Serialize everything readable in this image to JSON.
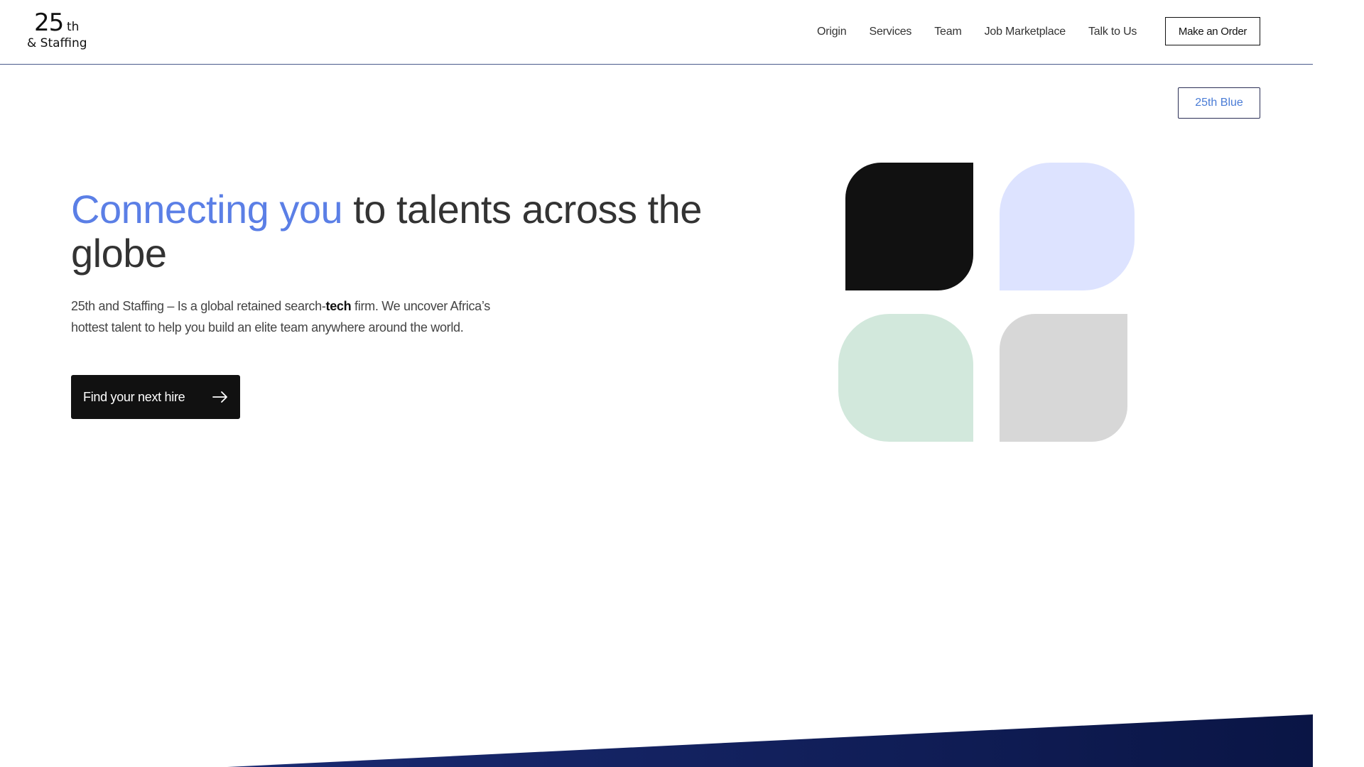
{
  "logo": {
    "number": "25",
    "suffix": "th",
    "tagline": "& Staffing"
  },
  "nav": {
    "items": [
      {
        "label": "Origin"
      },
      {
        "label": "Services"
      },
      {
        "label": "Team"
      },
      {
        "label": "Job Marketplace"
      },
      {
        "label": "Talk to Us"
      }
    ],
    "order_button": "Make an Order"
  },
  "switcher": {
    "label": "25th Blue"
  },
  "hero": {
    "title_accent": "Connecting you",
    "title_rest": " to talents across the globe",
    "desc_before": "25th and Staffing – Is a global retained search-",
    "desc_bold": "tech",
    "desc_after": " firm. We uncover Africa’s hottest talent to help you build an elite team anywhere around the world.",
    "cta_label": "Find your next hire",
    "cta_icon": "arrow-right-icon"
  },
  "colors": {
    "accent": "#5b7fe6",
    "cta_bg": "#111111",
    "shape_black": "#111111",
    "shape_blue": "#dde3ff",
    "shape_green": "#d2e8dc",
    "shape_gray": "#d7d7d7",
    "band": "#0d1a55"
  }
}
